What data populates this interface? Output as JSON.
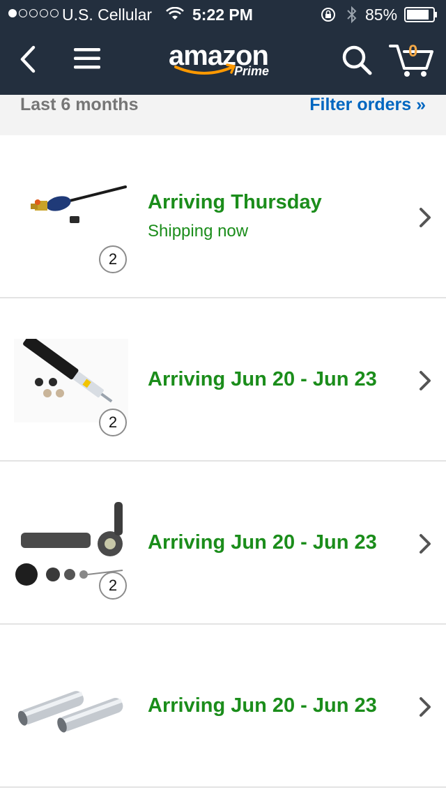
{
  "status_bar": {
    "carrier": "U.S. Cellular",
    "time": "5:22 PM",
    "battery_percent": "85%",
    "battery_level": 0.85,
    "signal_bars_filled": 1,
    "signal_bars_total": 5
  },
  "nav_bar": {
    "logo_wordmark": "amazon",
    "logo_subtext": "Prime",
    "cart_count": "0",
    "icons": [
      "back-arrow-icon",
      "hamburger-menu-icon",
      "search-icon",
      "cart-icon"
    ]
  },
  "filter_bar": {
    "period_label": "Last 6 months",
    "filter_label": "Filter orders »"
  },
  "orders": [
    {
      "title": "Arriving Thursday",
      "subtitle": "Shipping now",
      "quantity": "2",
      "product_icon": "tie-rod-icon"
    },
    {
      "title": "Arriving Jun 20 - Jun 23",
      "subtitle": "",
      "quantity": "2",
      "product_icon": "shock-absorber-icon"
    },
    {
      "title": "Arriving Jun 20 - Jun 23",
      "subtitle": "",
      "quantity": "2",
      "product_icon": "tie-rod-end-icon"
    },
    {
      "title": "Arriving Jun 20 - Jun 23",
      "subtitle": "",
      "quantity": "",
      "product_icon": "adjusting-sleeve-icon"
    }
  ],
  "colors": {
    "header_bg": "#232f3e",
    "arrival_green": "#1b8d1b",
    "link_blue": "#0066c0",
    "cart_orange": "#f3a847",
    "smile_orange": "#ff9900"
  }
}
